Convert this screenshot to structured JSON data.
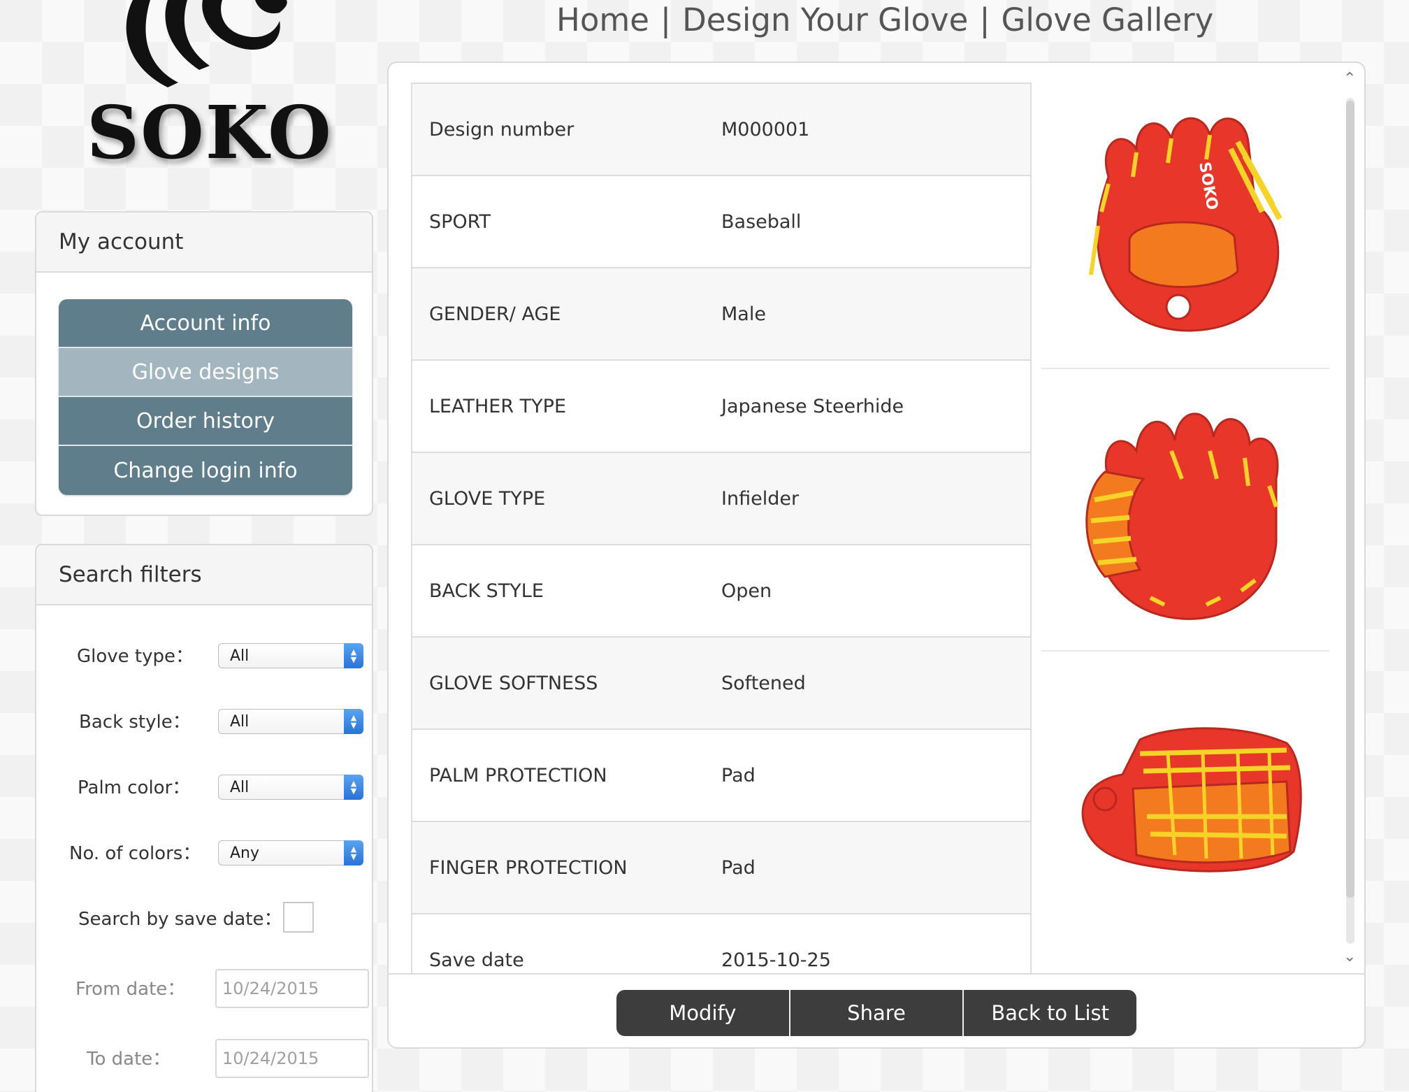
{
  "logo": {
    "text": "SOKO"
  },
  "nav": {
    "items": [
      "Home",
      "Design Your Glove",
      "Glove Gallery"
    ],
    "separator": "|"
  },
  "account": {
    "title": "My account",
    "menu": [
      {
        "label": "Account info",
        "active": false
      },
      {
        "label": "Glove designs",
        "active": true
      },
      {
        "label": "Order history",
        "active": false
      },
      {
        "label": "Change login info",
        "active": false
      }
    ]
  },
  "filters": {
    "title": "Search filters",
    "glove_type": {
      "label": "Glove type：",
      "value": "All"
    },
    "back_style": {
      "label": "Back style：",
      "value": "All"
    },
    "palm_color": {
      "label": "Palm color：",
      "value": "All"
    },
    "num_colors": {
      "label": "No. of colors：",
      "value": "Any"
    },
    "save_date": {
      "label": "Search by save date：",
      "checked": false
    },
    "from_date": {
      "label": "From date：",
      "value": "10/24/2015"
    },
    "to_date": {
      "label": "To date：",
      "value": "10/24/2015"
    }
  },
  "details": [
    {
      "label": "Design number",
      "value": "M000001"
    },
    {
      "label": "SPORT",
      "value": "Baseball"
    },
    {
      "label": "GENDER/ AGE",
      "value": "Male"
    },
    {
      "label": "LEATHER TYPE",
      "value": "Japanese Steerhide"
    },
    {
      "label": "GLOVE TYPE",
      "value": "Infielder"
    },
    {
      "label": "BACK STYLE",
      "value": "Open"
    },
    {
      "label": "GLOVE SOFTNESS",
      "value": "Softened"
    },
    {
      "label": "PALM PROTECTION",
      "value": "Pad"
    },
    {
      "label": "FINGER PROTECTION",
      "value": "Pad"
    },
    {
      "label": "Save date",
      "value": "2015-10-25"
    }
  ],
  "gallery": {
    "views": [
      "glove-back-view",
      "glove-palm-view",
      "glove-side-view"
    ],
    "glove_brand_text": "SOKO",
    "colors": {
      "leather": "#e8372a",
      "accent": "#f47a1f",
      "lace": "#f5d327"
    }
  },
  "actions": {
    "modify": "Modify",
    "share": "Share",
    "back": "Back to List"
  },
  "colors": {
    "menu_button": "#607d8b",
    "menu_button_active": "#a3b6bf",
    "action_bar": "#3d3d3d",
    "select_arrow": "#2a72d8"
  }
}
